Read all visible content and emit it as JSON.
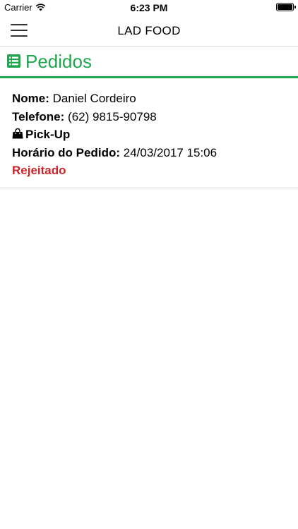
{
  "status_bar": {
    "carrier": "Carrier",
    "time": "6:23 PM",
    "icons": [
      "wifi-icon",
      "battery-icon"
    ]
  },
  "nav": {
    "title": "LAD FOOD",
    "menu_icon": "hamburger-menu-icon"
  },
  "section": {
    "title": "Pedidos",
    "icon": "list-icon",
    "accent_color": "#1fa64f"
  },
  "order": {
    "name_label": "Nome:",
    "name_value": "Daniel Cordeiro",
    "phone_label": "Telefone:",
    "phone_value": "(62) 9815-90798",
    "type_icon": "shopping-bag-icon",
    "type_label": "Pick-Up",
    "time_label": "Horário do Pedido:",
    "time_value": "24/03/2017 15:06",
    "status": "Rejeitado",
    "status_color": "#c9252b"
  }
}
